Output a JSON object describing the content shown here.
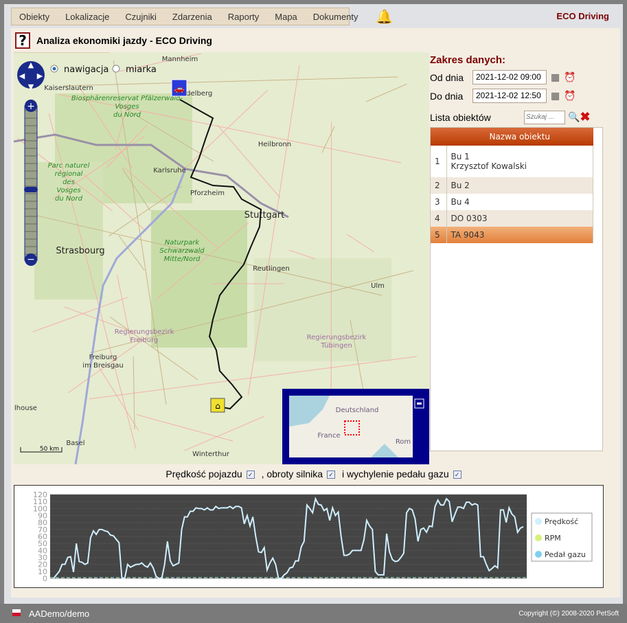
{
  "menu": [
    "Obiekty",
    "Lokalizacje",
    "Czujniki",
    "Zdarzenia",
    "Raporty",
    "Mapa",
    "Dokumenty"
  ],
  "brand": "ECO Driving",
  "page_title": "Analiza ekonomiki jazdy - ECO Driving",
  "help_label": "?",
  "map": {
    "mode_nav": "nawigacja",
    "mode_measure": "miarka",
    "mode_selected": "nawigacja",
    "scale": "50 km",
    "labels": [
      {
        "t": "Mannheim",
        "c": "#333"
      },
      {
        "t": "Heidelberg",
        "c": "#333"
      },
      {
        "t": "Kaiserslautern",
        "c": "#333"
      },
      {
        "t": "Heilbronn",
        "c": "#333"
      },
      {
        "t": "Karlsruhe",
        "c": "#333"
      },
      {
        "t": "Pforzheim",
        "c": "#333"
      },
      {
        "t": "Stuttgart",
        "c": "#222"
      },
      {
        "t": "Strasbourg",
        "c": "#222"
      },
      {
        "t": "Reutlingen",
        "c": "#333"
      },
      {
        "t": "Ulm",
        "c": "#333"
      },
      {
        "t": "Freiburg im Breisgau",
        "c": "#333"
      },
      {
        "t": "Mulhouse",
        "c": "#333"
      },
      {
        "t": "Basel",
        "c": "#333"
      },
      {
        "t": "Winterthur",
        "c": "#333"
      },
      {
        "t": "Biosphärenreservat Pfälzerwald-Vosges du Nord",
        "c": "#2a8a2a"
      },
      {
        "t": "Parc naturel régional des Vosges du Nord",
        "c": "#2a8a2a"
      },
      {
        "t": "Naturpark Schwarzwald Mitte/Nord",
        "c": "#2a8a2a"
      },
      {
        "t": "Regierungsbezirk Freiburg",
        "c": "#a070a0"
      },
      {
        "t": "Regierungsbezirk Tübingen",
        "c": "#a070a0"
      }
    ],
    "overview": {
      "labels": [
        "Deutschland",
        "France",
        "Rom"
      ]
    }
  },
  "range": {
    "title": "Zakres danych:",
    "from_label": "Od dnia",
    "from": "2021-12-02 09:00",
    "to_label": "Do dnia",
    "to": "2021-12-02 12:50"
  },
  "objects": {
    "title": "Lista obiektów",
    "search_placeholder": "Szukaj ...",
    "column": "Nazwa obiektu",
    "rows": [
      {
        "n": "1",
        "name": "Bu 1",
        "sub": "Krzysztof Kowalski"
      },
      {
        "n": "2",
        "name": "Bu 2"
      },
      {
        "n": "3",
        "name": "Bu 4"
      },
      {
        "n": "4",
        "name": "DO 0303"
      },
      {
        "n": "5",
        "name": "TA 9043",
        "selected": true
      }
    ]
  },
  "series_toggle": {
    "speed": "Prędkość pojazdu",
    "rpm": ", obroty silnika",
    "pedal": "i wychylenie pedału gazu",
    "speed_checked": true,
    "rpm_checked": true,
    "pedal_checked": true
  },
  "chart_data": {
    "type": "line",
    "ylim": [
      0,
      120
    ],
    "yticks": [
      0,
      10,
      20,
      30,
      40,
      50,
      60,
      70,
      80,
      90,
      100,
      110,
      120
    ],
    "grid": true,
    "legend": "right",
    "series": [
      {
        "name": "Prędkość",
        "color": "#cfefff",
        "values": [
          0,
          5,
          10,
          20,
          20,
          30,
          31,
          9,
          50,
          24,
          23,
          20,
          22,
          58,
          68,
          63,
          70,
          70,
          68,
          67,
          62,
          61,
          56,
          51,
          0,
          0,
          20,
          16,
          18,
          20,
          20,
          22,
          18,
          16,
          22,
          15,
          3,
          0,
          0,
          20,
          53,
          25,
          18,
          20,
          22,
          70,
          88,
          88,
          96,
          96,
          101,
          100,
          100,
          98,
          101,
          98,
          98,
          103,
          100,
          101,
          101,
          101,
          103,
          100,
          103,
          103,
          101,
          78,
          90,
          75,
          88,
          60,
          38,
          37,
          44,
          12,
          22,
          29,
          20,
          0,
          0,
          5,
          8,
          15,
          16,
          25,
          25,
          45,
          53,
          105,
          100,
          94,
          114,
          106,
          105,
          97,
          100,
          83,
          101,
          90,
          95,
          60,
          33,
          33,
          35,
          40,
          40,
          40,
          40,
          55,
          83,
          75,
          70,
          10,
          5,
          5,
          5,
          64,
          38,
          27,
          24,
          25,
          30,
          36,
          94,
          100,
          98,
          85,
          53,
          70,
          72,
          66,
          75,
          74,
          103,
          112,
          105,
          105,
          114,
          110,
          81,
          92,
          102,
          102,
          100,
          109,
          109,
          105,
          107,
          105,
          31,
          31,
          20,
          11,
          14,
          18,
          15,
          98,
          98,
          80,
          101,
          92,
          88,
          66,
          72,
          74
        ]
      },
      {
        "name": "RPM",
        "color": "#d6f27a",
        "values": [
          0,
          0
        ]
      },
      {
        "name": "Pedał gazu",
        "color": "#7fd0f0",
        "values": [
          0,
          0
        ]
      }
    ]
  },
  "footer": {
    "user": "AADemo/demo",
    "copyright": "Copyright (©) 2008-2020 PetSoft"
  }
}
